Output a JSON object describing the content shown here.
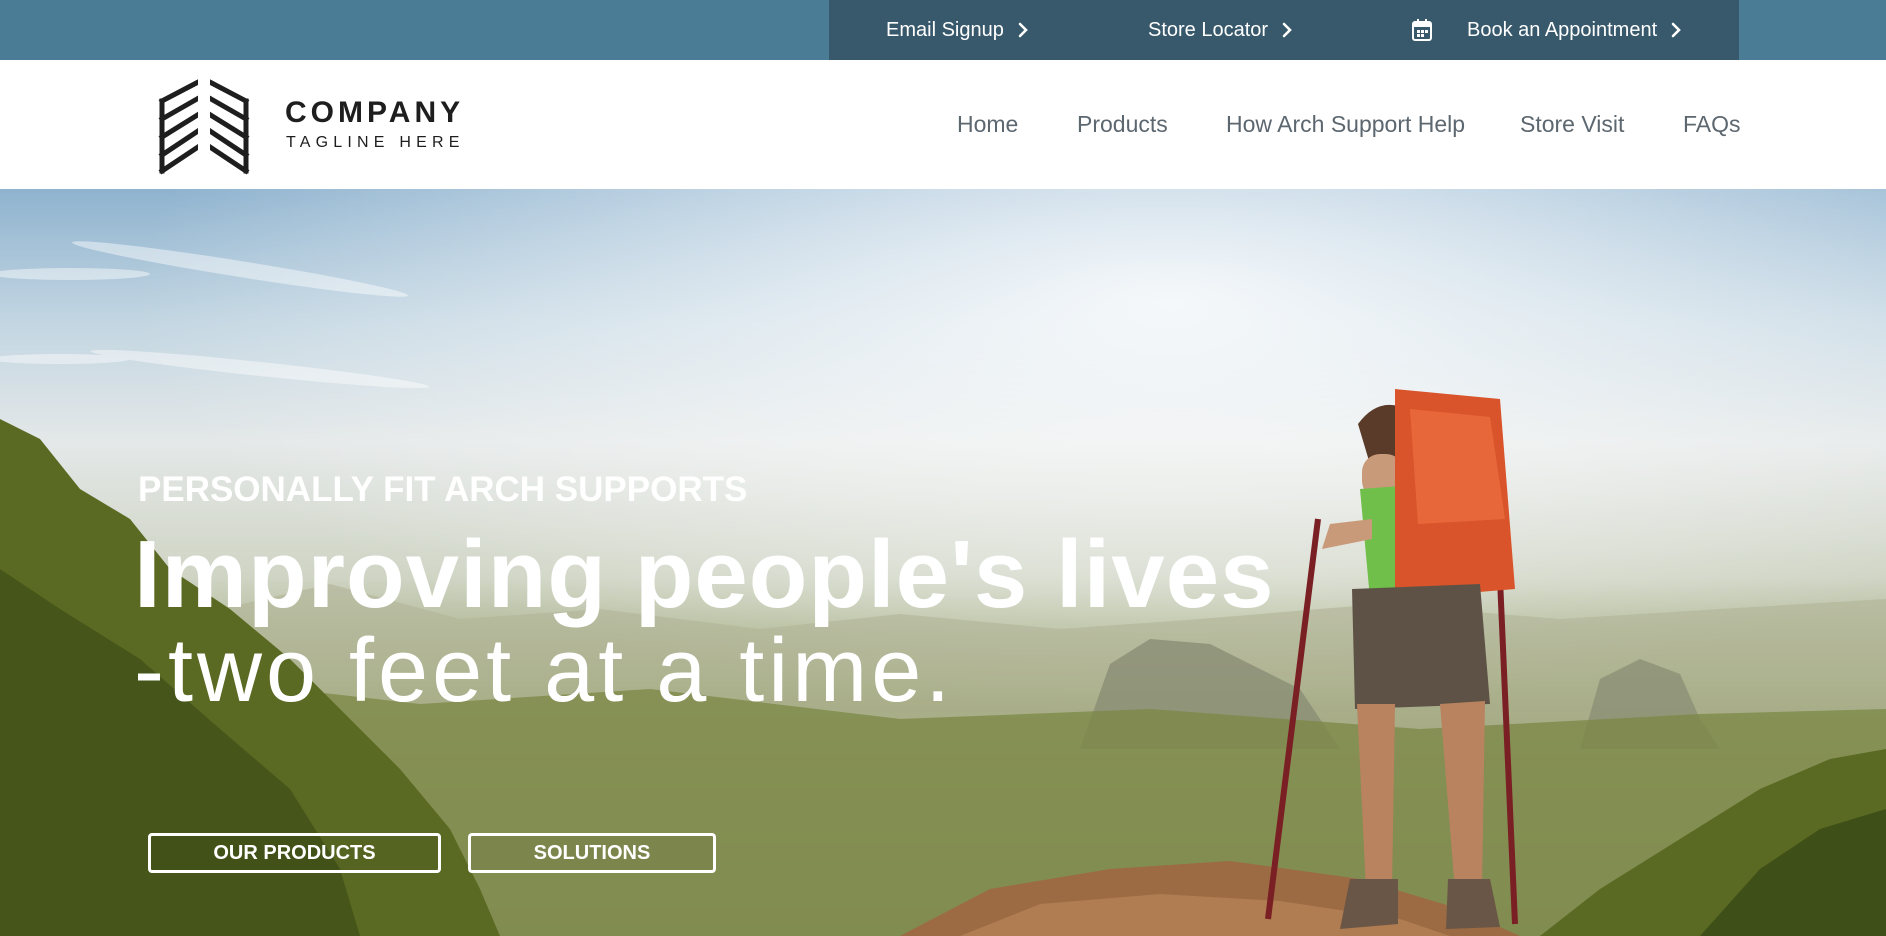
{
  "topbar": {
    "links": [
      {
        "label": "Email Signup",
        "icon": "chevron-right-icon"
      },
      {
        "label": "Store Locator",
        "icon": "chevron-right-icon"
      },
      {
        "label": "Book an Appointment",
        "icon": "chevron-right-icon",
        "leading_icon": "calendar-icon"
      }
    ]
  },
  "logo": {
    "name": "COMPANY",
    "tagline": "TAGLINE HERE"
  },
  "nav": {
    "items": [
      "Home",
      "Products",
      "How Arch Support Help",
      "Store Visit",
      "FAQs"
    ]
  },
  "hero": {
    "eyebrow": "PERSONALLY FIT ARCH SUPPORTS",
    "headline_line1": "Improving people's lives",
    "headline_line2": "-two feet at a time.",
    "buttons": [
      "OUR PRODUCTS",
      "SOLUTIONS"
    ]
  },
  "colors": {
    "topbar_bg": "#4a7c95",
    "topbar_links_bg": "#38596b",
    "nav_text": "#5c6770",
    "hero_text": "#ffffff"
  }
}
